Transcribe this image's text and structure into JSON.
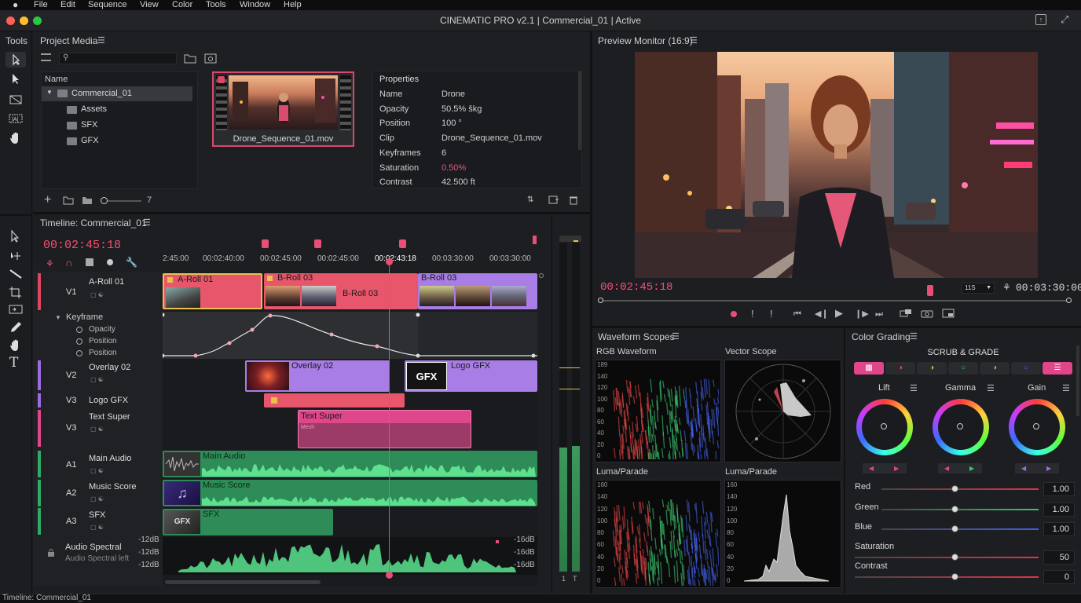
{
  "menu": {
    "apple": "",
    "items": [
      "File",
      "Edit",
      "Sequence",
      "View",
      "Color",
      "Tools",
      "Window",
      "Help"
    ]
  },
  "window": {
    "title": "CINEMATIC PRO v2.1 | Commercial_01 | Active"
  },
  "tools": {
    "label": "Tools"
  },
  "project_media": {
    "title": "Project Media",
    "tree_header": "Name",
    "tree": [
      "Commercial_01",
      "Assets",
      "SFX",
      "GFX"
    ],
    "thumb_label": "Drone_Sequence_01.mov",
    "zoom_value": "7"
  },
  "properties": {
    "title": "Properties",
    "rows": [
      {
        "k": "Name",
        "v": "Drone"
      },
      {
        "k": "Opacity",
        "v": "50.5% škg"
      },
      {
        "k": "Position",
        "v": "100 °"
      },
      {
        "k": "Clip",
        "v": "Drone_Sequence_01.mov"
      },
      {
        "k": "Keyframes",
        "v": "6"
      },
      {
        "k": "Saturation",
        "v": "0.50%"
      },
      {
        "k": "Contrast",
        "v": "42.500 ft"
      }
    ]
  },
  "timeline": {
    "title": "Timeline: Commercial_01",
    "timecode": "00:02:45:18",
    "ruler": [
      "2:45:00",
      "00:02:40:00",
      "00:02:45:00",
      "00:02:45:00",
      "00:02:43:18",
      "00:03:30:00",
      "00:03:30:00"
    ],
    "tracks": [
      {
        "id": "V1",
        "name": "A-Roll 01"
      },
      {
        "id": "V2",
        "name": "Overlay 02"
      },
      {
        "id": "V3",
        "name": "Logo GFX"
      },
      {
        "id": "V3",
        "name": "Text Super"
      },
      {
        "id": "A1",
        "name": "Main Audio"
      },
      {
        "id": "A2",
        "name": "Music Score"
      },
      {
        "id": "A3",
        "name": "SFX"
      }
    ],
    "keyframe": {
      "label": "Keyframe",
      "params": [
        "Opacity",
        "Position",
        "Position"
      ]
    },
    "clips": {
      "a_roll": "A-Roll 01",
      "b_roll1": "B-Roll 03",
      "b_roll1_inner": "B-Roll 03",
      "b_roll2": "B-Roll 03",
      "overlay": "Overlay 02",
      "logo": "Logo GFX",
      "gfx_badge": "GFX",
      "text_super": "Text Super",
      "text_sub": "Mesh",
      "main_audio": "Main Audio",
      "music": "Music Score",
      "sfx": "SFX",
      "sfx_thumb": "GFX"
    },
    "spectral": {
      "name": "Audio Spectral",
      "sub": "Audio Spectral left",
      "left": [
        "-12dB",
        "-12dB",
        "-12dB"
      ],
      "right": [
        "-16dB",
        "-16dB",
        "-16dB"
      ]
    },
    "status": "Timeline: Commercial_01"
  },
  "meter": {
    "labels": [
      "1",
      "T"
    ]
  },
  "preview": {
    "title": "Preview Monitor (16:9)",
    "timecode": "00:02:45:18",
    "end": "00:03:30:00",
    "zoom": "11S"
  },
  "scopes": {
    "title": "Waveform Scopes",
    "rgb": {
      "title": "RGB Waveform",
      "ticks": [
        "189",
        "140",
        "120",
        "100",
        "80",
        "60",
        "40",
        "20",
        "0"
      ]
    },
    "vector": {
      "title": "Vector Scope"
    },
    "luma": {
      "title": "Luma/Parade",
      "ticks": [
        "160",
        "140",
        "120",
        "100",
        "80",
        "60",
        "40",
        "20",
        "0"
      ]
    },
    "luma2": {
      "title": "Luma/Parade",
      "ticks": [
        "160",
        "140",
        "120",
        "100",
        "80",
        "60",
        "40",
        "20",
        "0"
      ]
    }
  },
  "color": {
    "title": "Color Grading",
    "subtitle": "SCRUB & GRADE",
    "wheels": [
      "Lift",
      "Gamma",
      "Gain"
    ],
    "sliders": [
      {
        "label": "Red",
        "value": "1.00",
        "color": "#e0334a"
      },
      {
        "label": "Green",
        "value": "1.00",
        "color": "#37c46a"
      },
      {
        "label": "Blue",
        "value": "1.00",
        "color": "#3f5fe0"
      },
      {
        "label": "Saturation",
        "value": "50",
        "color": "#e0334a"
      },
      {
        "label": "Contrast",
        "value": "0",
        "color": "#e0334a"
      }
    ]
  }
}
